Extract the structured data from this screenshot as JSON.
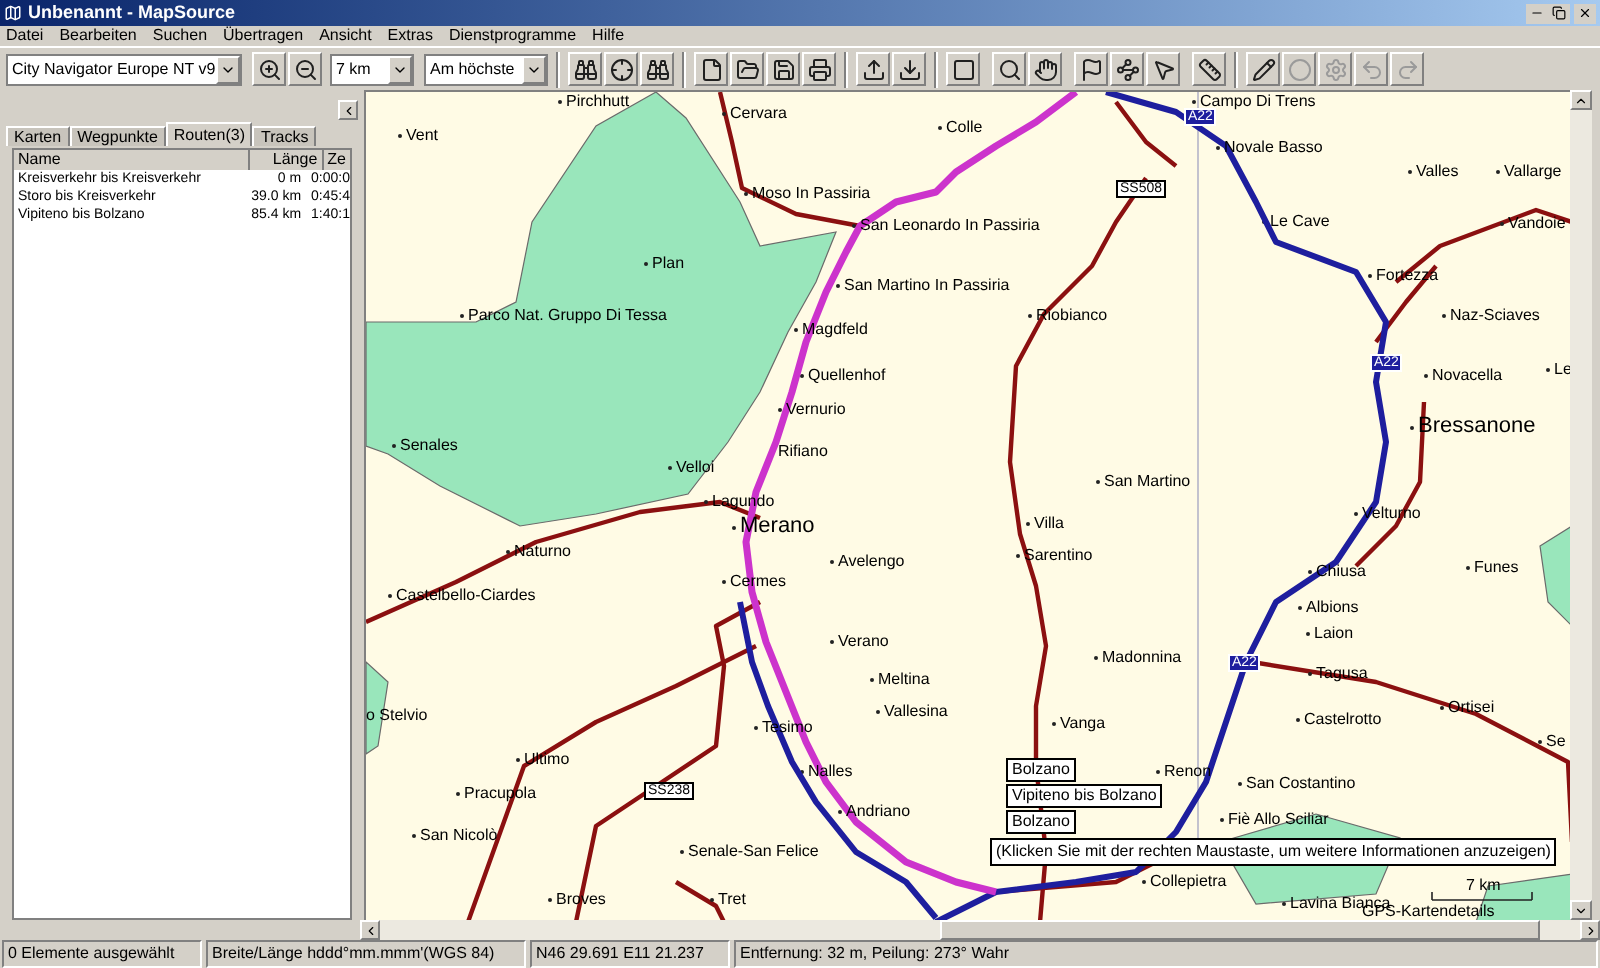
{
  "window": {
    "title": "Unbenannt - MapSource"
  },
  "menu": [
    "Datei",
    "Bearbeiten",
    "Suchen",
    "Übertragen",
    "Ansicht",
    "Extras",
    "Dienstprogramme",
    "Hilfe"
  ],
  "toolbar": {
    "map_product": "City Navigator Europe NT v9",
    "zoom": "7 km",
    "detail": "Am höchste"
  },
  "sidebar": {
    "tabs": [
      {
        "label": "Karten",
        "selected": false
      },
      {
        "label": "Wegpunkte",
        "selected": false
      },
      {
        "label": "Routen(3)",
        "selected": true
      },
      {
        "label": "Tracks",
        "selected": false
      }
    ],
    "columns": [
      "Name",
      "Länge",
      "Ze"
    ],
    "rows": [
      {
        "name": "Kreisverkehr bis Kreisverkehr",
        "length": "0 m",
        "time": "0:00:0"
      },
      {
        "name": "Storo bis Kreisverkehr",
        "length": "39.0 km",
        "time": "0:45:4"
      },
      {
        "name": "Vipiteno bis Bolzano",
        "length": "85.4 km",
        "time": "1:40:1"
      }
    ]
  },
  "map": {
    "places": [
      {
        "name": "Pirchhutt",
        "kind": "town"
      },
      {
        "name": "Campo Di Trens",
        "kind": "town"
      },
      {
        "name": "Cervara",
        "kind": "town"
      },
      {
        "name": "Vent",
        "kind": "town"
      },
      {
        "name": "Colle",
        "kind": "town"
      },
      {
        "name": "Novale Basso",
        "kind": "town"
      },
      {
        "name": "Valles",
        "kind": "town"
      },
      {
        "name": "Vallarge",
        "kind": "town"
      },
      {
        "name": "Moso In Passiria",
        "kind": "town"
      },
      {
        "name": "San Leonardo In Passiria",
        "kind": "town"
      },
      {
        "name": "Le Cave",
        "kind": "town"
      },
      {
        "name": "Vandoie",
        "kind": "town"
      },
      {
        "name": "Plan",
        "kind": "town"
      },
      {
        "name": "San Martino In Passiria",
        "kind": "town"
      },
      {
        "name": "Fortezza",
        "kind": "town"
      },
      {
        "name": "Parco Nat. Gruppo Di Tessa",
        "kind": "town"
      },
      {
        "name": "Magdfeld",
        "kind": "town"
      },
      {
        "name": "Riobianco",
        "kind": "town"
      },
      {
        "name": "Naz-Sciaves",
        "kind": "town"
      },
      {
        "name": "Quellenhof",
        "kind": "town"
      },
      {
        "name": "Novacella",
        "kind": "town"
      },
      {
        "name": "Le",
        "kind": "town"
      },
      {
        "name": "Vernurio",
        "kind": "town"
      },
      {
        "name": "Bressanone",
        "kind": "city"
      },
      {
        "name": "Senales",
        "kind": "town"
      },
      {
        "name": "Rifiano",
        "kind": "town"
      },
      {
        "name": "Velloi",
        "kind": "town"
      },
      {
        "name": "San Martino",
        "kind": "town"
      },
      {
        "name": "Lagundo",
        "kind": "town"
      },
      {
        "name": "Merano",
        "kind": "city"
      },
      {
        "name": "Villa",
        "kind": "town"
      },
      {
        "name": "Velturno",
        "kind": "town"
      },
      {
        "name": "Naturno",
        "kind": "town"
      },
      {
        "name": "Avelengo",
        "kind": "town"
      },
      {
        "name": "Sarentino",
        "kind": "town"
      },
      {
        "name": "Chiusa",
        "kind": "town"
      },
      {
        "name": "Funes",
        "kind": "town"
      },
      {
        "name": "Castelbello-Ciardes",
        "kind": "town"
      },
      {
        "name": "Cermes",
        "kind": "town"
      },
      {
        "name": "Albions",
        "kind": "town"
      },
      {
        "name": "Verano",
        "kind": "town"
      },
      {
        "name": "Madonnina",
        "kind": "town"
      },
      {
        "name": "Laion",
        "kind": "town"
      },
      {
        "name": "Meltina",
        "kind": "town"
      },
      {
        "name": "Tagusa",
        "kind": "town"
      },
      {
        "name": "o Stelvio",
        "kind": "town"
      },
      {
        "name": "Tesimo",
        "kind": "town"
      },
      {
        "name": "Vallesina",
        "kind": "town"
      },
      {
        "name": "Vanga",
        "kind": "town"
      },
      {
        "name": "Castelrotto",
        "kind": "town"
      },
      {
        "name": "Ortisei",
        "kind": "town"
      },
      {
        "name": "Se",
        "kind": "town"
      },
      {
        "name": "Ultimo",
        "kind": "town"
      },
      {
        "name": "Nalles",
        "kind": "town"
      },
      {
        "name": "Renon",
        "kind": "town"
      },
      {
        "name": "San Costantino",
        "kind": "town"
      },
      {
        "name": "Pracupola",
        "kind": "town"
      },
      {
        "name": "Andriano",
        "kind": "town"
      },
      {
        "name": "Fiè Allo Sciliar",
        "kind": "town"
      },
      {
        "name": "San Nicolò",
        "kind": "town"
      },
      {
        "name": "Senale-San Felice",
        "kind": "town"
      },
      {
        "name": "Collepietra",
        "kind": "town"
      },
      {
        "name": "Broves",
        "kind": "town"
      },
      {
        "name": "Tret",
        "kind": "town"
      },
      {
        "name": "Lavina Bianca",
        "kind": "town"
      }
    ],
    "road_labels": [
      {
        "label": "A22",
        "kind": "motorway"
      },
      {
        "label": "SS508",
        "kind": "state"
      },
      {
        "label": "A22",
        "kind": "motorway"
      },
      {
        "label": "A22",
        "kind": "motorway"
      },
      {
        "label": "SS238",
        "kind": "state"
      }
    ],
    "route_popup": [
      "Bolzano",
      "Vipiteno bis Bolzano",
      "Bolzano"
    ],
    "hint": "(Klicken Sie mit der rechten Maustaste, um weitere Informationen anzuzeigen)",
    "scale": "7 km",
    "caption": "GPS-Kartendetails"
  },
  "status_bar": [
    "0 Elemente ausgewählt",
    "Breite/Länge hddd°mm.mmm'(WGS 84)",
    "N46 29.691 E11 21.237",
    "Entfernung: 32 m, Peilung: 273° Wahr"
  ]
}
